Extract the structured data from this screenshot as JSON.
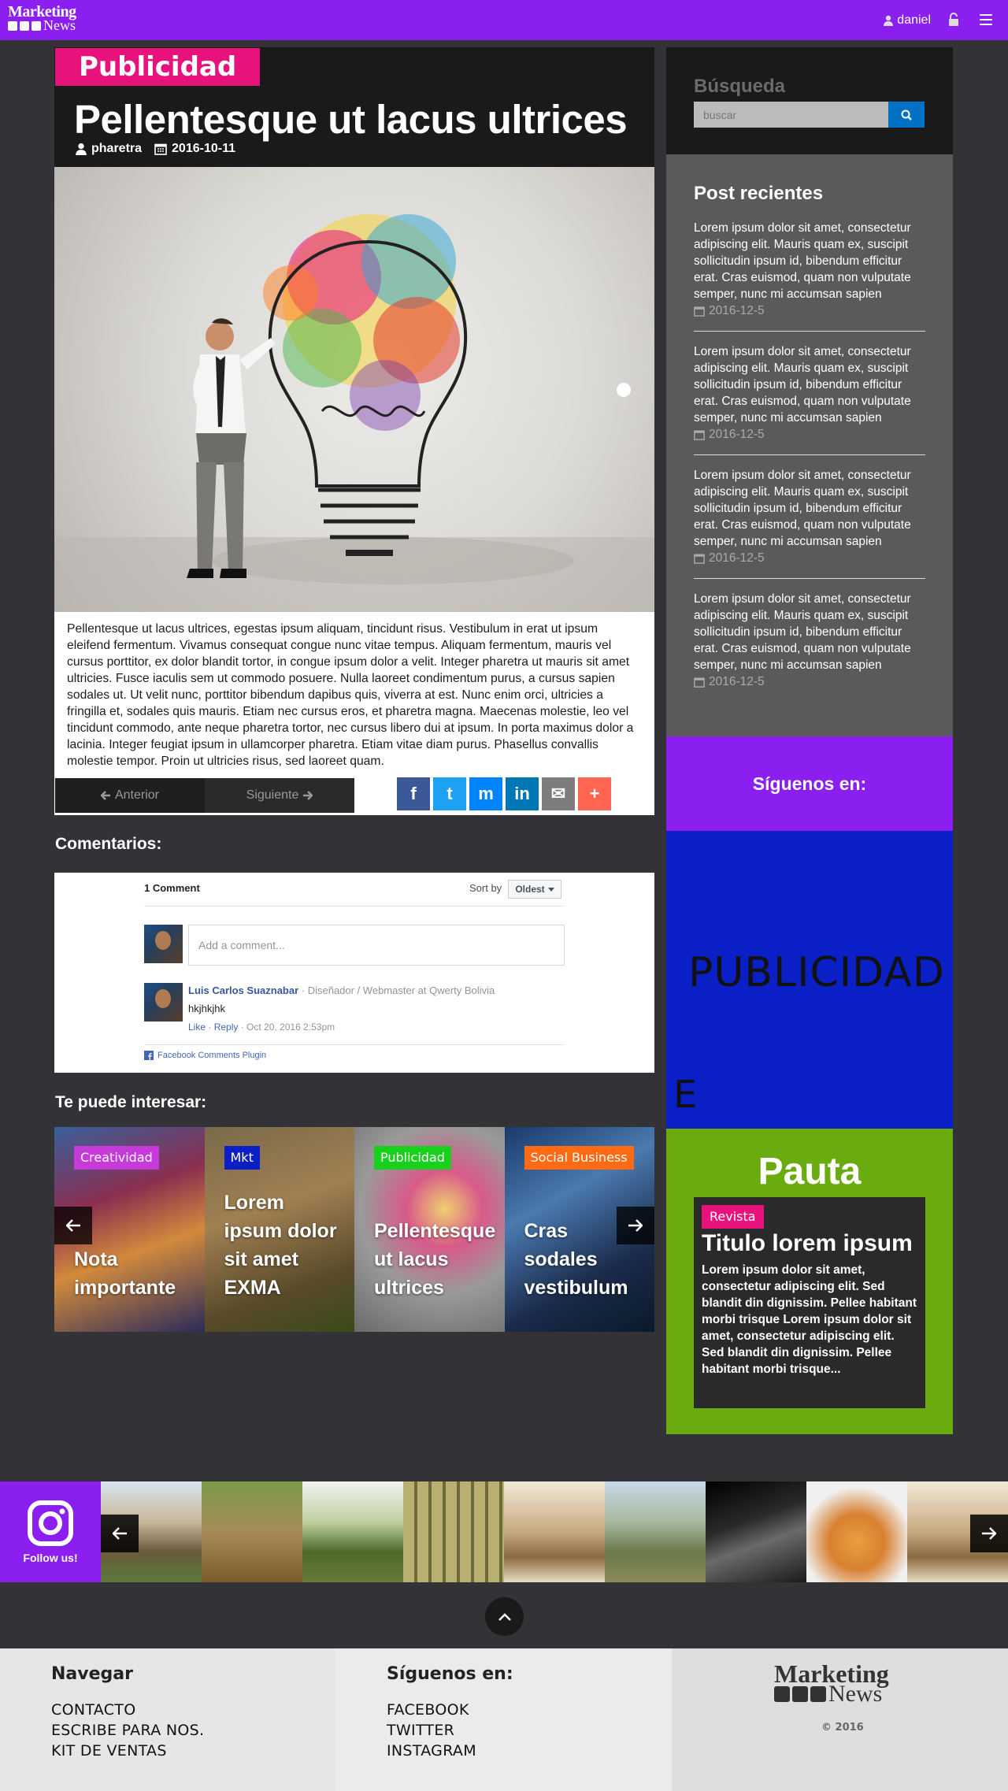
{
  "nav": {
    "user": "daniel",
    "logo_line1": "Marketing",
    "logo_line2": "News"
  },
  "article": {
    "category": "Publicidad",
    "title": "Pellentesque ut lacus ultrices",
    "author": "pharetra",
    "date": "2016-10-11",
    "body": "Pellentesque ut lacus ultrices, egestas ipsum aliquam, tincidunt risus. Vestibulum in erat ut ipsum eleifend fermentum. Vivamus consequat congue nunc vitae tempus. Aliquam fermentum, mauris vel cursus porttitor, ex dolor blandit tortor, in congue ipsum dolor a velit. Integer pharetra ut mauris sit amet ultricies. Fusce iaculis sem ut commodo posuere. Nulla laoreet condimentum purus, a cursus sapien sodales ut. Ut velit nunc, porttitor bibendum dapibus quis, viverra at est. Nunc enim orci, ultricies a fringilla et, sodales quis mauris. Etiam nec cursus eros, et pharetra magna. Maecenas molestie, leo vel tincidunt commodo, ante neque pharetra tortor, nec cursus libero dui at ipsum. In porta maximus dolor a lacinia. Integer feugiat ipsum in ullamcorper pharetra. Etiam vitae diam purus. Phasellus convallis molestie tempor. Proin ut ultricies risus, sed laoreet quam.",
    "prev_label": "Anterior",
    "next_label": "Siguiente"
  },
  "share": [
    {
      "name": "facebook",
      "glyph": "f",
      "color": "#3b5998"
    },
    {
      "name": "twitter",
      "glyph": "t",
      "color": "#1da1f2"
    },
    {
      "name": "messenger",
      "glyph": "m",
      "color": "#0084ff"
    },
    {
      "name": "linkedin",
      "glyph": "in",
      "color": "#0077b5"
    },
    {
      "name": "email",
      "glyph": "✉",
      "color": "#7d7d7d"
    },
    {
      "name": "more",
      "glyph": "+",
      "color": "#ff6550"
    }
  ],
  "comments": {
    "title": "Comentarios:",
    "count": "1 Comment",
    "sort_label": "Sort by",
    "sort_value": "Oldest",
    "placeholder": "Add a comment...",
    "author": "Luis Carlos Suaznabar",
    "role": " · Diseñador / Webmaster at Qwerty Bolivia",
    "text": "hkjhkjhk",
    "like": "Like",
    "reply": "Reply",
    "time": " · Oct 20, 2016 2:53pm",
    "plugin": "Facebook Comments Plugin"
  },
  "related": {
    "title": "Te puede interesar:",
    "items": [
      {
        "badge": "Creatividad",
        "badge_color": "#c53ad8",
        "title": "Nota importante"
      },
      {
        "badge": "Mkt",
        "badge_color": "#0a1fc6",
        "title": "Lorem ipsum dolor sit amet EXMA"
      },
      {
        "badge": "Publicidad",
        "badge_color": "#19d11c",
        "title": "Pellentesque ut lacus ultrices"
      },
      {
        "badge": "Social Business",
        "badge_color": "#ff6a13",
        "title": "Cras sodales vestibulum"
      }
    ]
  },
  "sidebar": {
    "search_title": "Búsqueda",
    "search_placeholder": "buscar",
    "recent_title": "Post recientes",
    "posts": [
      {
        "text": "Lorem ipsum dolor sit amet, consectetur adipiscing elit. Mauris quam ex, suscipit sollicitudin ipsum id, bibendum efficitur erat. Cras euismod, quam non vulputate semper, nunc mi accumsan sapien",
        "date": "2016-12-5"
      },
      {
        "text": "Lorem ipsum dolor sit amet, consectetur adipiscing elit. Mauris quam ex, suscipit sollicitudin ipsum id, bibendum efficitur erat. Cras euismod, quam non vulputate semper, nunc mi accumsan sapien",
        "date": "2016-12-5"
      },
      {
        "text": "Lorem ipsum dolor sit amet, consectetur adipiscing elit. Mauris quam ex, suscipit sollicitudin ipsum id, bibendum efficitur erat. Cras euismod, quam non vulputate semper, nunc mi accumsan sapien",
        "date": "2016-12-5"
      },
      {
        "text": "Lorem ipsum dolor sit amet, consectetur adipiscing elit. Mauris quam ex, suscipit sollicitudin ipsum id, bibendum efficitur erat. Cras euismod, quam non vulputate semper, nunc mi accumsan sapien",
        "date": "2016-12-5"
      }
    ],
    "follow_title": "Síguenos en:",
    "ad_text": "PUBLICIDAD",
    "ad_letter": "E",
    "pauta_title": "Pauta",
    "pauta_badge": "Revista",
    "pauta_heading": "Titulo lorem ipsum",
    "pauta_body": "Lorem ipsum dolor sit amet, consectetur adipiscing elit. Sed blandit din dignissim. Pellee habitant morbi trisque Lorem ipsum dolor sit amet, consectetur adipiscing elit. Sed blandit din dignissim. Pellee habitant morbi trisque..."
  },
  "instagram": {
    "label": "Follow us!"
  },
  "footer": {
    "nav_title": "Navegar",
    "nav_links": [
      "CONTACTO",
      "ESCRIBE PARA NOS.",
      "KIT DE VENTAS"
    ],
    "social_title": "Síguenos en:",
    "social_links": [
      "FACEBOOK",
      "TWITTER",
      "INSTAGRAM"
    ],
    "logo_line1": "Marketing",
    "logo_line2": "News",
    "copyright": "© 2016"
  }
}
